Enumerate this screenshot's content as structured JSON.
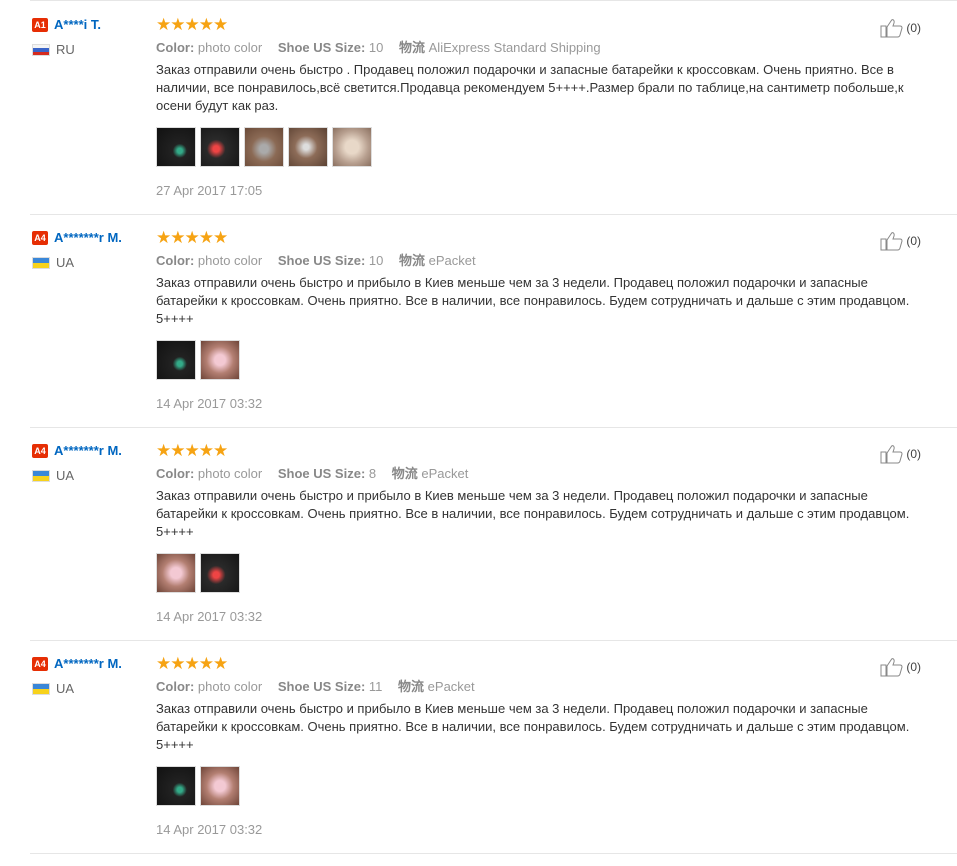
{
  "attr_labels": {
    "color": "Color:",
    "size": "Shoe US Size:",
    "shipping": "物流"
  },
  "stars": "★★★★★",
  "reviews": [
    {
      "badge": "A1",
      "name": "A****i T.",
      "country": "RU",
      "flag": "ru",
      "color_value": "photo color",
      "size_value": "10",
      "shipping_value": "AliExpress Standard Shipping",
      "text": "Заказ отправили очень быстро . Продавец положил подарочки и запасные батарейки к кроссовкам. Очень приятно. Все в наличии, все понравилось,всё светится.Продавца рекомендуем 5++++.Размер брали по таблице,на сантиметр побольше,к осени будут как раз.",
      "photos": [
        "p-dark1",
        "p-dark2",
        "p-bed1",
        "p-bed2",
        "p-light"
      ],
      "date": "27 Apr 2017 17:05",
      "helpful": "(0)"
    },
    {
      "badge": "A4",
      "name": "A*******r M.",
      "country": "UA",
      "flag": "ua",
      "color_value": "photo color",
      "size_value": "10",
      "shipping_value": "ePacket",
      "text": "Заказ отправили очень быстро и прибыло в Киев меньше чем за 3 недели. Продавец положил подарочки и запасные батарейки к кроссовкам. Очень приятно. Все в наличии, все понравилось. Будем сотрудничать и дальше с этим продавцом. 5++++",
      "photos": [
        "p-dark1",
        "p-pink"
      ],
      "date": "14 Apr 2017 03:32",
      "helpful": "(0)"
    },
    {
      "badge": "A4",
      "name": "A*******r M.",
      "country": "UA",
      "flag": "ua",
      "color_value": "photo color",
      "size_value": "8",
      "shipping_value": "ePacket",
      "text": "Заказ отправили очень быстро и прибыло в Киев меньше чем за 3 недели. Продавец положил подарочки и запасные батарейки к кроссовкам. Очень приятно. Все в наличии, все понравилось. Будем сотрудничать и дальше с этим продавцом. 5++++",
      "photos": [
        "p-pink",
        "p-dark2"
      ],
      "date": "14 Apr 2017 03:32",
      "helpful": "(0)"
    },
    {
      "badge": "A4",
      "name": "A*******r M.",
      "country": "UA",
      "flag": "ua",
      "color_value": "photo color",
      "size_value": "11",
      "shipping_value": "ePacket",
      "text": "Заказ отправили очень быстро и прибыло в Киев меньше чем за 3 недели. Продавец положил подарочки и запасные батарейки к кроссовкам. Очень приятно. Все в наличии, все понравилось. Будем сотрудничать и дальше с этим продавцом. 5++++",
      "photos": [
        "p-dark1",
        "p-pink"
      ],
      "date": "14 Apr 2017 03:32",
      "helpful": "(0)"
    }
  ]
}
